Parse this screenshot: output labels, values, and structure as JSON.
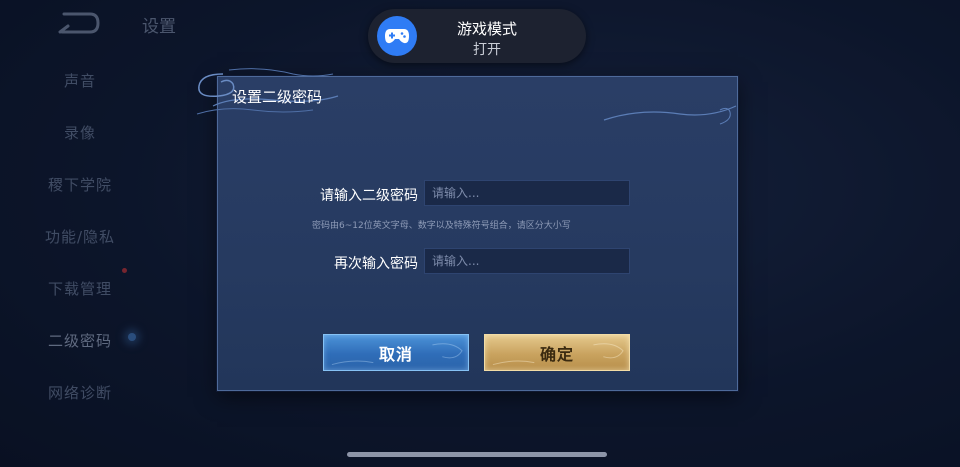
{
  "background": {
    "title": "设置",
    "sidebar": [
      {
        "label": "声音",
        "red_dot": false
      },
      {
        "label": "录像",
        "red_dot": false
      },
      {
        "label": "稷下学院",
        "red_dot": false
      },
      {
        "label": "功能/隐私",
        "red_dot": false
      },
      {
        "label": "下载管理",
        "red_dot": true
      },
      {
        "label": "二级密码",
        "red_dot": false,
        "active": true
      },
      {
        "label": "网络诊断",
        "red_dot": false
      }
    ]
  },
  "toast": {
    "title": "游戏模式",
    "status": "打开",
    "icon": "gamepad-icon",
    "icon_color": "#2f7cf5"
  },
  "dialog": {
    "title": "设置二级密码",
    "password_label": "请输入二级密码",
    "password_placeholder": "请输入...",
    "hint": "密码由6~12位英文字母、数字以及特殊符号组合，请区分大小写",
    "confirm_label": "再次输入密码",
    "confirm_placeholder": "请输入...",
    "cancel_button": "取消",
    "ok_button": "确定"
  },
  "colors": {
    "cancel_button": "#2f6db8",
    "ok_button": "#c9a35f",
    "dialog_bg": "#2a3e66"
  }
}
